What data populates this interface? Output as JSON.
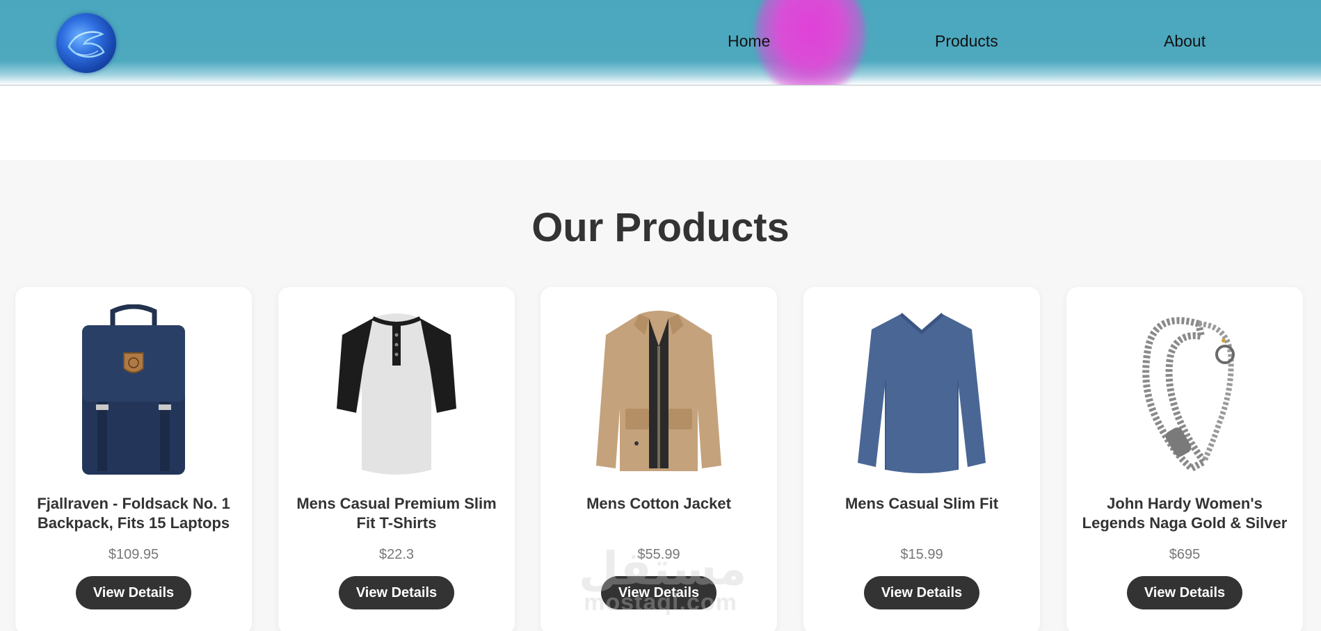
{
  "header": {
    "nav": {
      "home": "Home",
      "products": "Products",
      "about": "About"
    },
    "colors": {
      "bar": "#4ea9bf",
      "accent_blob": "#d94fd6",
      "logo": "#2f6fe0"
    }
  },
  "section": {
    "title": "Our Products"
  },
  "products": [
    {
      "title": "Fjallraven - Foldsack No. 1 Backpack, Fits 15 Laptops",
      "price": "$109.95",
      "button": "View Details",
      "image_icon": "backpack-image"
    },
    {
      "title": "Mens Casual Premium Slim Fit T-Shirts",
      "price": "$22.3",
      "button": "View Details",
      "image_icon": "tshirt-image"
    },
    {
      "title": "Mens Cotton Jacket",
      "price": "$55.99",
      "button": "View Details",
      "image_icon": "jacket-image"
    },
    {
      "title": "Mens Casual Slim Fit",
      "price": "$15.99",
      "button": "View Details",
      "image_icon": "sweater-image"
    },
    {
      "title": "John Hardy Women's Legends Naga Gold & Silver Dragon Station Chain Bracelet",
      "price": "$695",
      "button": "View Details",
      "image_icon": "bracelet-image"
    }
  ],
  "watermark": {
    "arabic": "مستقل",
    "latin": "mostaql.com"
  }
}
